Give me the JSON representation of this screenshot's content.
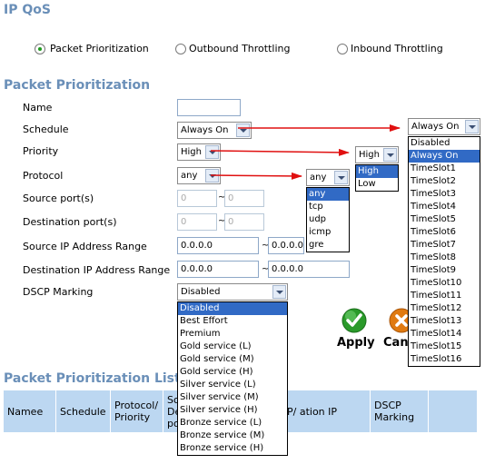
{
  "page_title": "IP QoS",
  "mode_options": [
    {
      "label": "Packet Prioritization",
      "selected": true
    },
    {
      "label": "Outbound Throttling",
      "selected": false
    },
    {
      "label": "Inbound Throttling",
      "selected": false
    }
  ],
  "section_title": "Packet Prioritization",
  "form": {
    "name_label": "Name",
    "name_value": "",
    "schedule_label": "Schedule",
    "schedule_value": "Always On",
    "priority_label": "Priority",
    "priority_value": "High",
    "protocol_label": "Protocol",
    "protocol_value": "any",
    "source_port_label": "Source port(s)",
    "source_port_from": "0",
    "source_port_to": "0",
    "dest_port_label": "Destination port(s)",
    "dest_port_from": "0",
    "dest_port_to": "0",
    "source_ip_label": "Source IP Address Range",
    "source_ip_from": "0.0.0.0",
    "source_ip_to": "0.0.0.0",
    "dest_ip_label": "Destination IP Address Range",
    "dest_ip_from": "0.0.0.0",
    "dest_ip_to": "0.0.0.0",
    "dscp_label": "DSCP Marking",
    "dscp_value": "Disabled",
    "range_sep": "~"
  },
  "schedule_dropdown": {
    "selected_value": "Always On",
    "options": [
      "Disabled",
      "Always On",
      "TimeSlot1",
      "TimeSlot2",
      "TimeSlot3",
      "TimeSlot4",
      "TimeSlot5",
      "TimeSlot6",
      "TimeSlot7",
      "TimeSlot8",
      "TimeSlot9",
      "TimeSlot10",
      "TimeSlot11",
      "TimeSlot12",
      "TimeSlot13",
      "TimeSlot14",
      "TimeSlot15",
      "TimeSlot16"
    ],
    "highlighted": "Always On"
  },
  "priority_dropdown": {
    "selected_value": "High",
    "options": [
      "High",
      "Low"
    ],
    "highlighted": "High"
  },
  "protocol_dropdown": {
    "selected_value": "any",
    "options": [
      "any",
      "tcp",
      "udp",
      "icmp",
      "gre"
    ],
    "highlighted": "any"
  },
  "dscp_dropdown": {
    "options": [
      "Disabled",
      "Best Effort",
      "Premium",
      "Gold service (L)",
      "Gold service (M)",
      "Gold service (H)",
      "Silver service (L)",
      "Silver service (M)",
      "Silver service (H)",
      "Bronze service (L)",
      "Bronze service (M)",
      "Bronze service (H)"
    ],
    "highlighted": "Disabled"
  },
  "buttons": {
    "apply_label": "Apply",
    "cancel_label": "Can"
  },
  "list": {
    "title": "Packet Prioritization List",
    "headers": [
      "Namee",
      "Schedule",
      "Protocol/ Priority",
      "So De po",
      "P/ ation IP",
      "DSCP Marking",
      ""
    ]
  },
  "colors": {
    "section_title": "#6a8fb8",
    "table_header_bg": "#bcd7f1",
    "selection_bg": "#316ac5",
    "arrow_red": "#e01010",
    "apply_green": "#2a9a2a",
    "cancel_orange": "#e07a10"
  }
}
